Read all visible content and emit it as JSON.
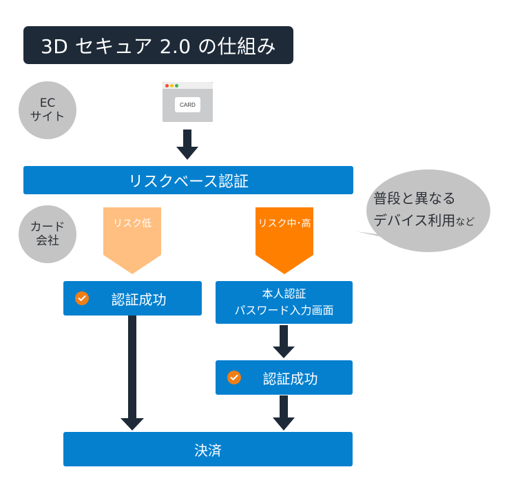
{
  "title": "3D セキュア 2.0 の仕組み",
  "actors": {
    "ec_site": {
      "line1": "EC",
      "line2": "サイト"
    },
    "card_company": {
      "line1": "カード",
      "line2": "会社"
    }
  },
  "browser": {
    "card_label": "CARD"
  },
  "risk_based_auth": "リスクベース認証",
  "speech_bubble": {
    "line1": "普段と異なる",
    "line2_main": "デバイス利用",
    "line2_suffix": "など"
  },
  "risk_low": {
    "label": "リスク低",
    "color": "#ffbf80"
  },
  "risk_high": {
    "label": "リスク中･高",
    "color": "#ff7f00"
  },
  "left_success": "認証成功",
  "identity_auth": {
    "line1": "本人認証",
    "line2": "パスワード入力画面"
  },
  "right_success": "認証成功",
  "payment": "決済",
  "colors": {
    "primary": "#0480cf",
    "dark": "#1e2a38",
    "check": "#f07e16",
    "circle": "#c4c4c4"
  }
}
